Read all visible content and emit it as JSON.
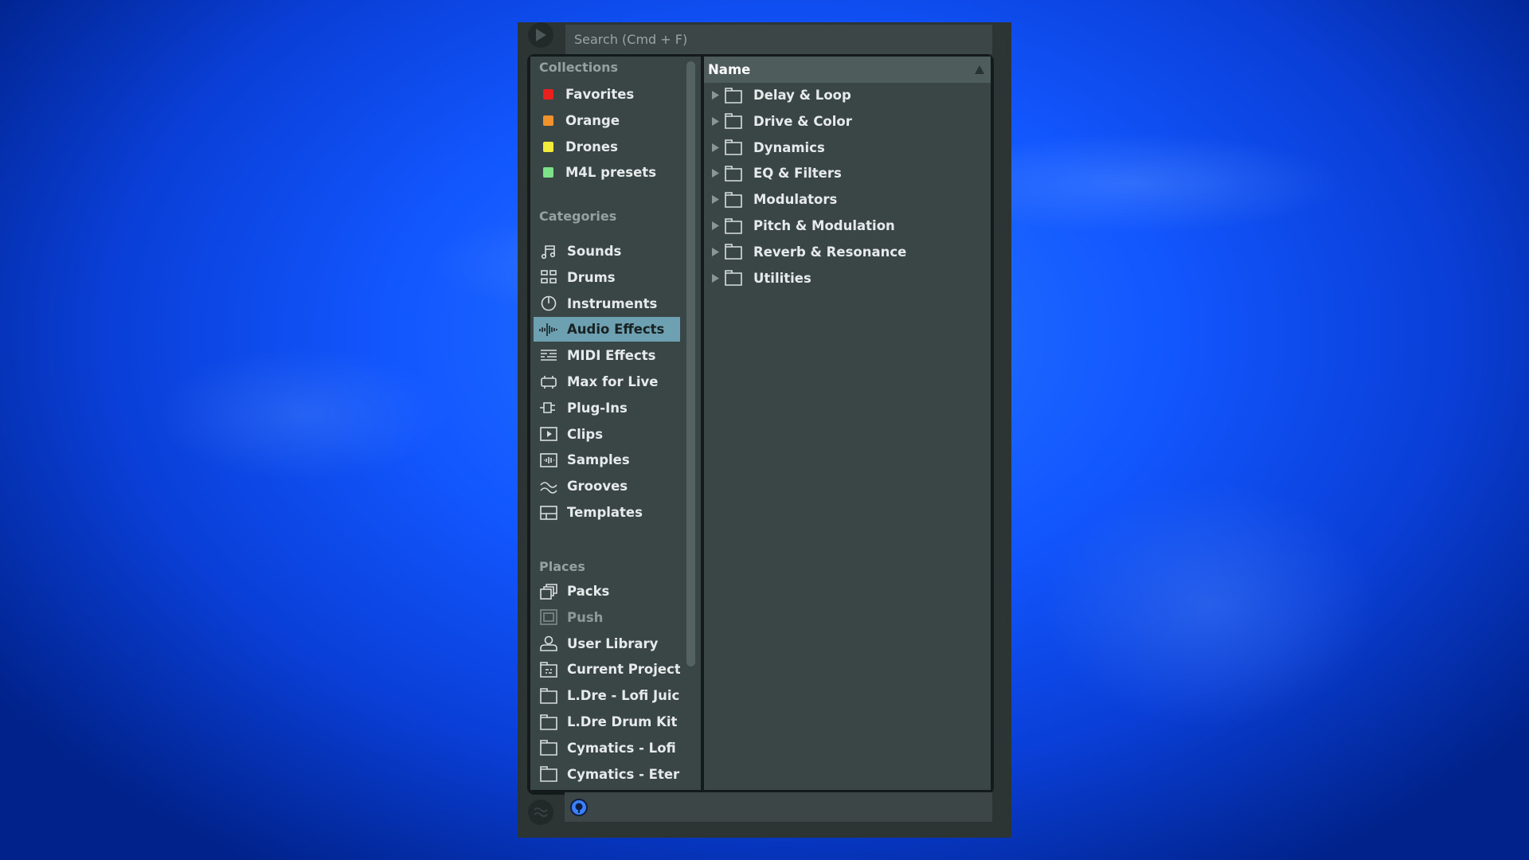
{
  "search": {
    "placeholder": "Search (Cmd + F)",
    "value": ""
  },
  "sidebar": {
    "collections": {
      "title": "Collections",
      "items": [
        {
          "label": "Favorites",
          "color": "#e8201e"
        },
        {
          "label": "Orange",
          "color": "#f0922c"
        },
        {
          "label": "Drones",
          "color": "#f2ea3a"
        },
        {
          "label": "M4L presets",
          "color": "#7fe08a"
        }
      ]
    },
    "categories": {
      "title": "Categories",
      "items": [
        {
          "label": "Sounds",
          "icon": "music-note-icon"
        },
        {
          "label": "Drums",
          "icon": "drum-pads-icon"
        },
        {
          "label": "Instruments",
          "icon": "power-knob-icon"
        },
        {
          "label": "Audio Effects",
          "icon": "waveform-icon",
          "selected": true
        },
        {
          "label": "MIDI Effects",
          "icon": "midi-lines-icon"
        },
        {
          "label": "Max for Live",
          "icon": "max-for-live-icon"
        },
        {
          "label": "Plug-Ins",
          "icon": "plug-icon"
        },
        {
          "label": "Clips",
          "icon": "clip-play-icon"
        },
        {
          "label": "Samples",
          "icon": "sample-wave-icon"
        },
        {
          "label": "Grooves",
          "icon": "groove-wave-icon"
        },
        {
          "label": "Templates",
          "icon": "template-icon"
        }
      ]
    },
    "places": {
      "title": "Places",
      "items": [
        {
          "label": "Packs",
          "icon": "packs-icon"
        },
        {
          "label": "Push",
          "icon": "push-icon",
          "disabled": true
        },
        {
          "label": "User Library",
          "icon": "user-icon"
        },
        {
          "label": "Current Project",
          "icon": "project-folder-icon"
        },
        {
          "label": "L.Dre - Lofi Juice",
          "icon": "folder-icon"
        },
        {
          "label": "L.Dre Drum Kit V",
          "icon": "folder-icon"
        },
        {
          "label": "Cymatics - Lofi T",
          "icon": "folder-icon"
        },
        {
          "label": "Cymatics - Etern",
          "icon": "folder-icon"
        }
      ]
    }
  },
  "content": {
    "column_header": "Name",
    "sort_direction": "ascending",
    "folders": [
      "Delay & Loop",
      "Drive & Color",
      "Dynamics",
      "EQ & Filters",
      "Modulators",
      "Pitch & Modulation",
      "Reverb & Resonance",
      "Utilities"
    ]
  },
  "colors": {
    "selection": "#6da0b1",
    "hotswap": "#3b80ff"
  }
}
